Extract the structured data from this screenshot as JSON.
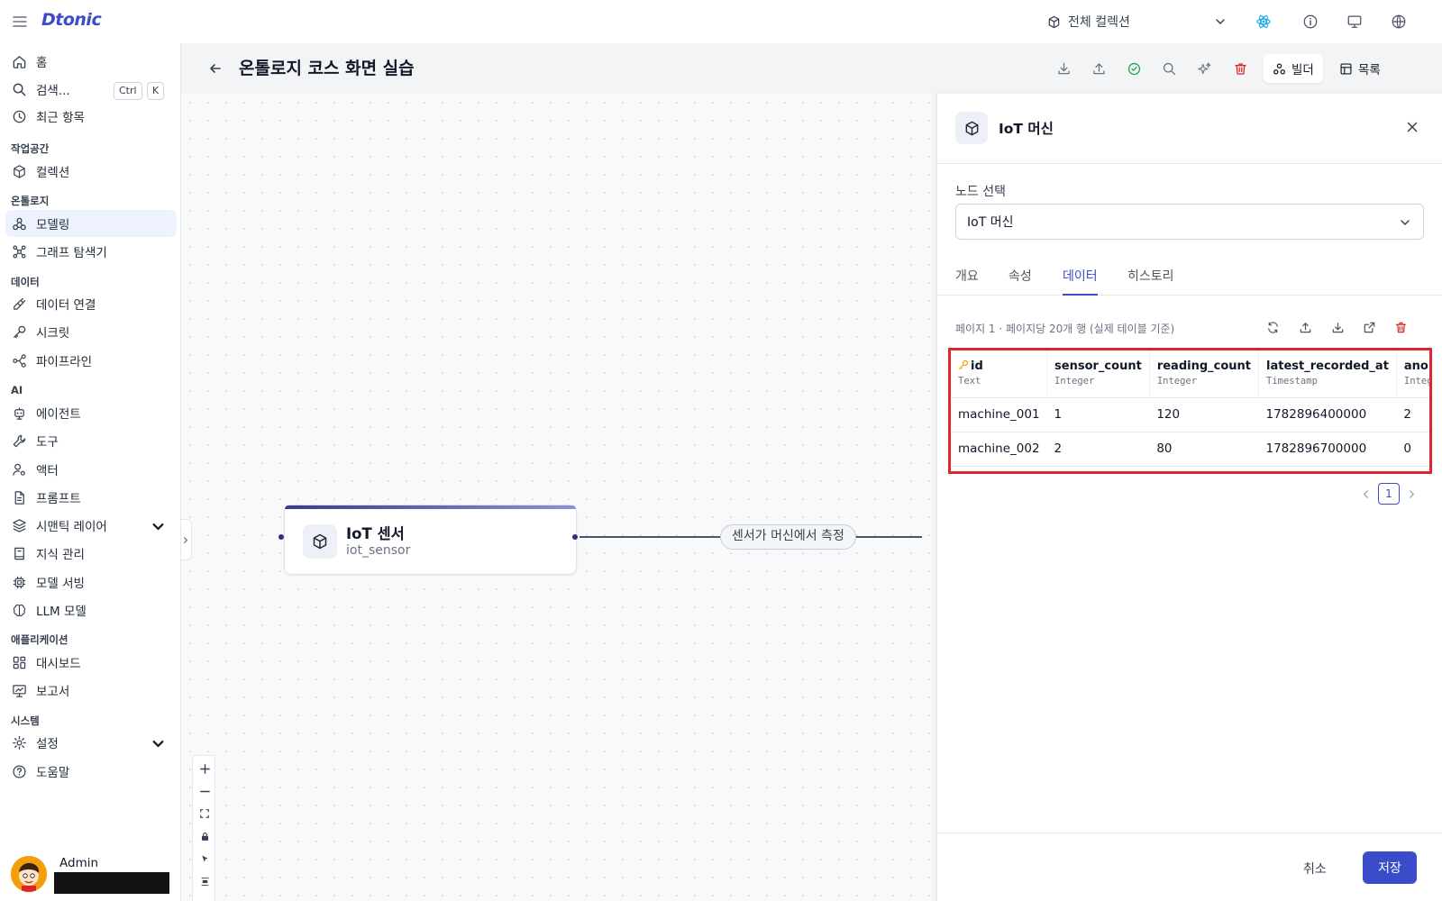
{
  "app": {
    "logo": "Dtonic"
  },
  "topbar": {
    "collection_select": "전체 컬렉션"
  },
  "sidebar": {
    "items": [
      {
        "label": "홈",
        "icon": "home-icon"
      },
      {
        "label": "검색...",
        "icon": "search-icon",
        "shortcut": [
          "Ctrl",
          "K"
        ]
      },
      {
        "label": "최근 항목",
        "icon": "clock-icon"
      }
    ],
    "sections": [
      {
        "title": "작업공간",
        "items": [
          {
            "label": "컬렉션",
            "icon": "cube-icon"
          }
        ]
      },
      {
        "title": "온톨로지",
        "items": [
          {
            "label": "모델링",
            "icon": "modeling-icon",
            "active": true
          },
          {
            "label": "그래프 탐색기",
            "icon": "graph-icon"
          }
        ]
      },
      {
        "title": "데이터",
        "items": [
          {
            "label": "데이터 연결",
            "icon": "plug-icon"
          },
          {
            "label": "시크릿",
            "icon": "key-icon"
          },
          {
            "label": "파이프라인",
            "icon": "pipeline-icon"
          }
        ]
      },
      {
        "title": "AI",
        "items": [
          {
            "label": "에이전트",
            "icon": "robot-icon"
          },
          {
            "label": "도구",
            "icon": "wrench-icon"
          },
          {
            "label": "액터",
            "icon": "user-gear-icon"
          },
          {
            "label": "프롬프트",
            "icon": "document-icon"
          },
          {
            "label": "시맨틱 레이어",
            "icon": "layers-icon"
          },
          {
            "label": "지식 관리",
            "icon": "book-icon"
          },
          {
            "label": "모델 서빙",
            "icon": "chip-icon"
          },
          {
            "label": "LLM 모델",
            "icon": "brain-icon"
          }
        ]
      },
      {
        "title": "애플리케이션",
        "items": [
          {
            "label": "대시보드",
            "icon": "dashboard-icon"
          },
          {
            "label": "보고서",
            "icon": "report-icon"
          }
        ]
      },
      {
        "title": "시스템",
        "items": [
          {
            "label": "설정",
            "icon": "gear-icon"
          },
          {
            "label": "도움말",
            "icon": "help-icon"
          }
        ]
      }
    ],
    "user": {
      "name": "Admin"
    }
  },
  "header": {
    "title": "온톨로지 코스 화면 실습",
    "builder_label": "빌더",
    "list_label": "목록"
  },
  "canvas": {
    "node": {
      "title": "IoT 센서",
      "subtitle": "iot_sensor"
    },
    "edge_label": "센서가 머신에서 측정"
  },
  "panel": {
    "title": "IoT 머신",
    "node_select_label": "노드 선택",
    "node_select_value": "IoT 머신",
    "tabs": [
      {
        "label": "개요",
        "active": false
      },
      {
        "label": "속성",
        "active": false
      },
      {
        "label": "데이터",
        "active": true
      },
      {
        "label": "히스토리",
        "active": false
      }
    ],
    "data_meta": "페이지 1 · 페이지당 20개 행 (실제 테이블 기준)",
    "columns": [
      {
        "name": "id",
        "type": "Text",
        "key": true
      },
      {
        "name": "sensor_count",
        "type": "Integer"
      },
      {
        "name": "reading_count",
        "type": "Integer"
      },
      {
        "name": "latest_recorded_at",
        "type": "Timestamp"
      },
      {
        "name": "anoma",
        "type": "Integer"
      }
    ],
    "rows": [
      [
        "machine_001",
        "1",
        "120",
        "1782896400000",
        "2"
      ],
      [
        "machine_002",
        "2",
        "80",
        "1782896700000",
        "0"
      ]
    ],
    "page": "1",
    "cancel_label": "취소",
    "save_label": "저장"
  },
  "colors": {
    "accent": "#3b4cca",
    "highlight": "#e0262b",
    "key": "#f59e0b",
    "validate": "#16a34a",
    "delete": "#dc2626"
  }
}
